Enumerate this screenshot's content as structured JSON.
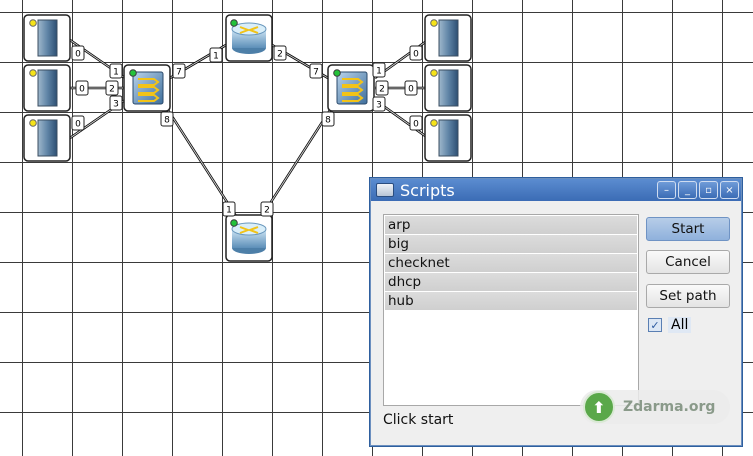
{
  "topology": {
    "servers_left": [
      {
        "port": "0"
      },
      {
        "port": "0"
      },
      {
        "port": "0"
      }
    ],
    "switch_left": {
      "ports": [
        "1",
        "2",
        "3",
        "7",
        "8"
      ]
    },
    "router_top": {
      "ports": [
        "1",
        "2"
      ]
    },
    "router_bottom": {
      "ports": [
        "1",
        "2"
      ]
    },
    "switch_right": {
      "ports": [
        "7",
        "1",
        "2",
        "3",
        "8"
      ]
    },
    "servers_right": [
      {
        "port": "0"
      },
      {
        "port": "0"
      },
      {
        "port": "0"
      }
    ]
  },
  "window": {
    "title": "Scripts",
    "controls": [
      "–",
      "_",
      "▫",
      "×"
    ],
    "scripts": [
      "arp",
      "big",
      "checknet",
      "dhcp",
      "hub"
    ],
    "buttons": {
      "start": "Start",
      "cancel": "Cancel",
      "set_path": "Set path"
    },
    "all_label": "All",
    "all_checked": true,
    "status": "Click start"
  },
  "watermark": {
    "text": "Zdarma.org"
  },
  "colors": {
    "title_bar": "#3b6cb5",
    "led_yellow": "#f5e31a",
    "led_green": "#23c23a",
    "cable": "#000000"
  }
}
